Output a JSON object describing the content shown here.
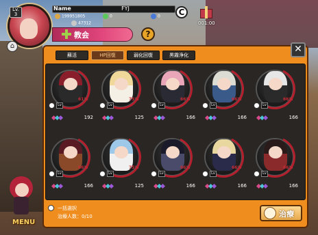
{
  "header": {
    "level": "Lv.\n3",
    "name_label": "Name",
    "player_name": "FYJ",
    "gold": "199951805",
    "gems": "0",
    "points": "47312",
    "timer": "001:00"
  },
  "title": "教会",
  "tabs": [
    {
      "label": "蘇活",
      "active": false
    },
    {
      "label": "HP回復",
      "active": true
    },
    {
      "label": "弱化回復",
      "active": false
    },
    {
      "label": "黒霧浄化",
      "active": false
    }
  ],
  "cards": [
    {
      "lv": "Lv",
      "hp_pct": "61%",
      "hp": "192",
      "colors": [
        "#8a1e2a",
        "#2a2a2a"
      ]
    },
    {
      "lv": "Lv",
      "hp_pct": "75%",
      "hp": "125",
      "colors": [
        "#f0d89a",
        "#f5f0e6"
      ]
    },
    {
      "lv": "Lv",
      "hp_pct": "66%",
      "hp": "166",
      "colors": [
        "#e8a6b8",
        "#2a2a34"
      ]
    },
    {
      "lv": "Lv",
      "hp_pct": "66%",
      "hp": "166",
      "colors": [
        "#dcdcd4",
        "#3a5a8a"
      ]
    },
    {
      "lv": "Lv",
      "hp_pct": "66%",
      "hp": "166",
      "colors": [
        "#e6e6e6",
        "#2a2a2a"
      ]
    },
    {
      "lv": "Lv",
      "hp_pct": "66%",
      "hp": "166",
      "colors": [
        "#5a1a24",
        "#8a4a2a"
      ]
    },
    {
      "lv": "Lv",
      "hp_pct": "75%",
      "hp": "125",
      "colors": [
        "#9ec8e8",
        "#f0f0f0"
      ]
    },
    {
      "lv": "Lv",
      "hp_pct": "66%",
      "hp": "166",
      "colors": [
        "#1a1a2a",
        "#4a4a6a"
      ]
    },
    {
      "lv": "Lv",
      "hp_pct": "66%",
      "hp": "166",
      "colors": [
        "#e8d8a0",
        "#2a2a4a"
      ]
    },
    {
      "lv": "Lv",
      "hp_pct": "66%",
      "hp": "166",
      "colors": [
        "#2a1a1a",
        "#8a2a2a"
      ]
    }
  ],
  "footer": {
    "select_all": "一括選択",
    "heal_count": "治療人数：0/10",
    "heal_button": "治療"
  },
  "menu_label": "MENU"
}
